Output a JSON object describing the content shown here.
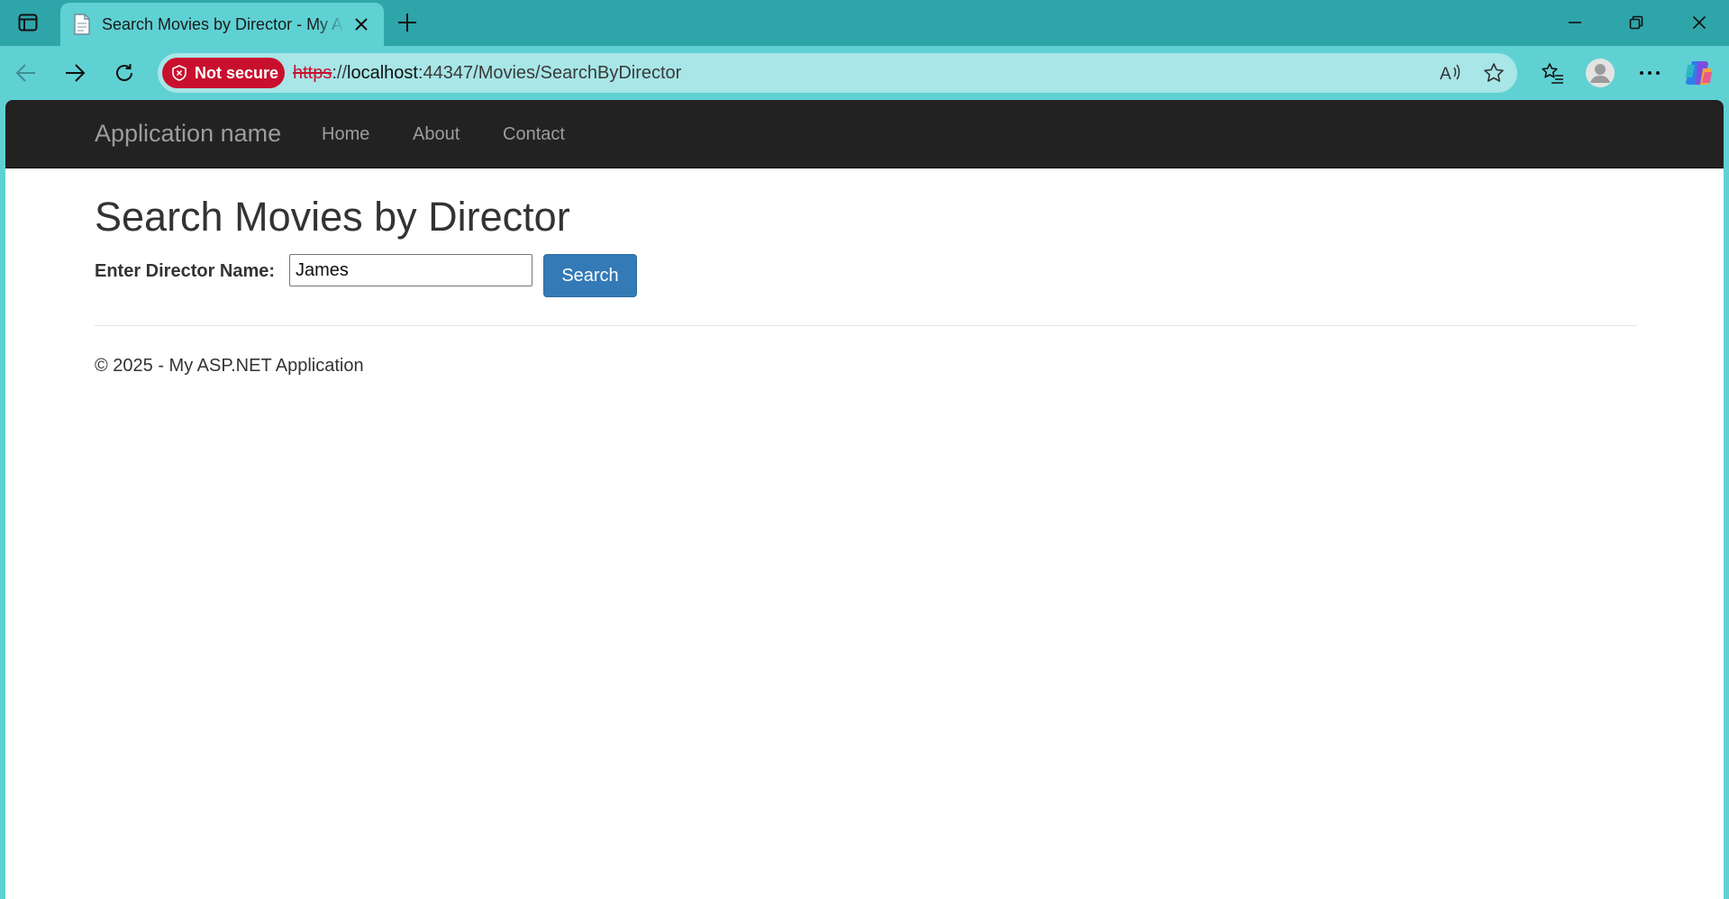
{
  "browser": {
    "tab": {
      "title": "Search Movies by Director - My ASP.NET Application"
    },
    "address": {
      "security_label": "Not secure",
      "url_scheme": "https",
      "url_sep": "://",
      "url_host": "localhost",
      "url_rest": ":44347/Movies/SearchByDirector"
    },
    "icons": [
      "tab-actions-icon",
      "page-icon",
      "close-icon",
      "new-tab-icon",
      "minimize-icon",
      "restore-icon",
      "window-close-icon",
      "back-icon",
      "forward-icon",
      "refresh-icon",
      "shield-icon",
      "read-aloud-icon",
      "favorite-star-icon",
      "favorites-icon",
      "profile-icon",
      "more-icon",
      "copilot-icon"
    ]
  },
  "site": {
    "brand": "Application name",
    "nav": [
      "Home",
      "About",
      "Contact"
    ]
  },
  "page": {
    "heading": "Search Movies by Director",
    "form": {
      "label": "Enter Director Name:",
      "input_value": "James",
      "button_label": "Search"
    },
    "footer": "© 2025 - My ASP.NET Application"
  },
  "colors": {
    "chrome": "#2ea5a9",
    "toolbar": "#5fd1d3",
    "navbar": "#222222",
    "primary_button": "#337ab7",
    "not_secure": "#c8102e"
  }
}
